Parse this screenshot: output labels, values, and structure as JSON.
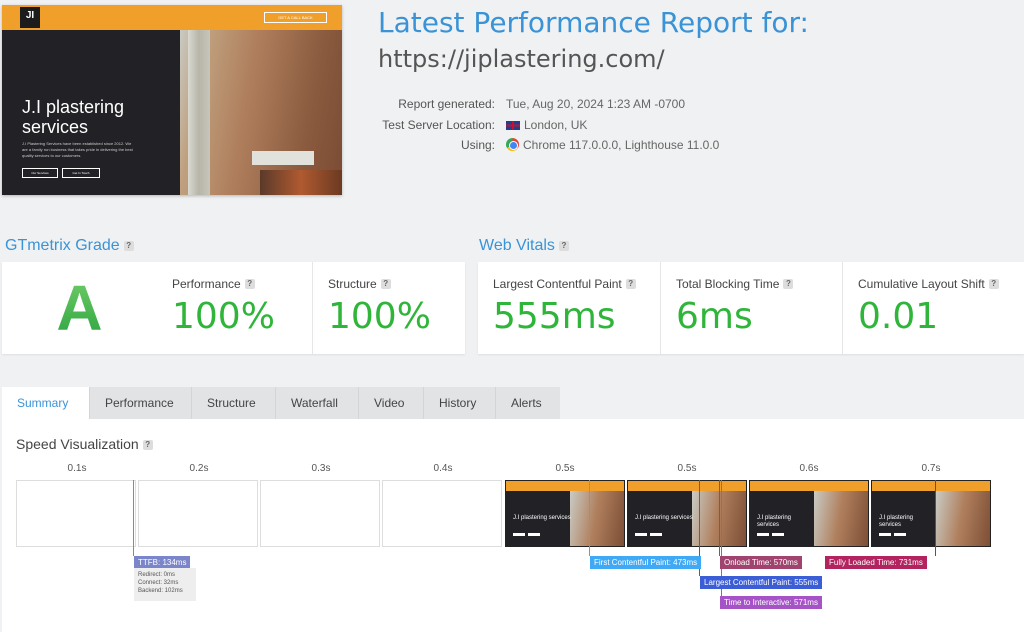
{
  "hero": {
    "logo": "JI",
    "cta": "GET A CALL BACK",
    "title": "J.I plastering services",
    "text": "J.I Plastering Services have been established since 2012. We are a family run business that takes pride in delivering the best quality services to our customers.",
    "btn1": "Our Services",
    "btn2": "Get In Touch"
  },
  "header": {
    "title": "Latest Performance Report for:",
    "url": "https://jiplastering.com/",
    "meta": [
      {
        "label": "Report generated:",
        "value": "Tue, Aug 20, 2024 1:23 AM -0700"
      },
      {
        "label": "Test Server Location:",
        "value": "London, UK",
        "icon": "uk-flag-icon"
      },
      {
        "label": "Using:",
        "value": "Chrome 117.0.0.0, Lighthouse 11.0.0",
        "icon": "chrome-icon"
      }
    ]
  },
  "grade": {
    "heading": "GTmetrix Grade",
    "letter": "A",
    "performance_label": "Performance",
    "performance_value": "100%",
    "structure_label": "Structure",
    "structure_value": "100%"
  },
  "vitals": {
    "heading": "Web Vitals",
    "items": [
      {
        "label": "Largest Contentful Paint",
        "value": "555ms"
      },
      {
        "label": "Total Blocking Time",
        "value": "6ms"
      },
      {
        "label": "Cumulative Layout Shift",
        "value": "0.01"
      }
    ]
  },
  "tabs": [
    "Summary",
    "Performance",
    "Structure",
    "Waterfall",
    "Video",
    "History",
    "Alerts"
  ],
  "speed": {
    "heading": "Speed Visualization",
    "ticks": [
      "0.1s",
      "0.2s",
      "0.3s",
      "0.4s",
      "0.5s",
      "0.5s",
      "0.6s",
      "0.7s"
    ],
    "frame_text": [
      "J.I plastering services",
      "J.I plastering services",
      "J.I plastering services",
      "J.I plastering services"
    ],
    "ttfb": {
      "label": "TTFB: 134ms",
      "redirect": "Redirect: 0ms",
      "connect": "Connect: 32ms",
      "backend": "Backend: 102ms"
    },
    "markers": [
      {
        "label": "First Contentful Paint: 473ms",
        "color": "#3fa9f5"
      },
      {
        "label": "Onload Time: 570ms",
        "color": "#a0436e"
      },
      {
        "label": "Fully Loaded Time: 731ms",
        "color": "#b2235f"
      },
      {
        "label": "Largest Contentful Paint: 555ms",
        "color": "#3b5ed6"
      },
      {
        "label": "Time to Interactive: 571ms",
        "color": "#a653c8"
      }
    ]
  }
}
